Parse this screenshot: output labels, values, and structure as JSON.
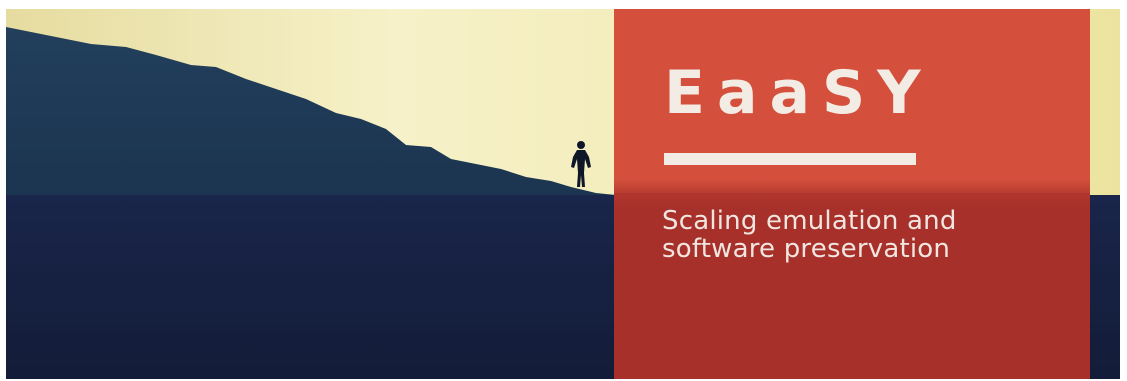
{
  "banner": {
    "title": "EaaSY",
    "subtitle_lines": [
      "Scaling emulation and",
      "software preservation"
    ]
  },
  "colors": {
    "sky_light": "#f2ecb0",
    "sky_bright": "#f7f3cf",
    "mountain": "#1f3b56",
    "ground": "#151f3d",
    "panel_top": "#d4503c",
    "panel_bottom": "#a8302b",
    "text": "#f3ece4"
  },
  "image_elements": [
    "mountain-silhouette",
    "person-silhouette",
    "desert-plain"
  ]
}
